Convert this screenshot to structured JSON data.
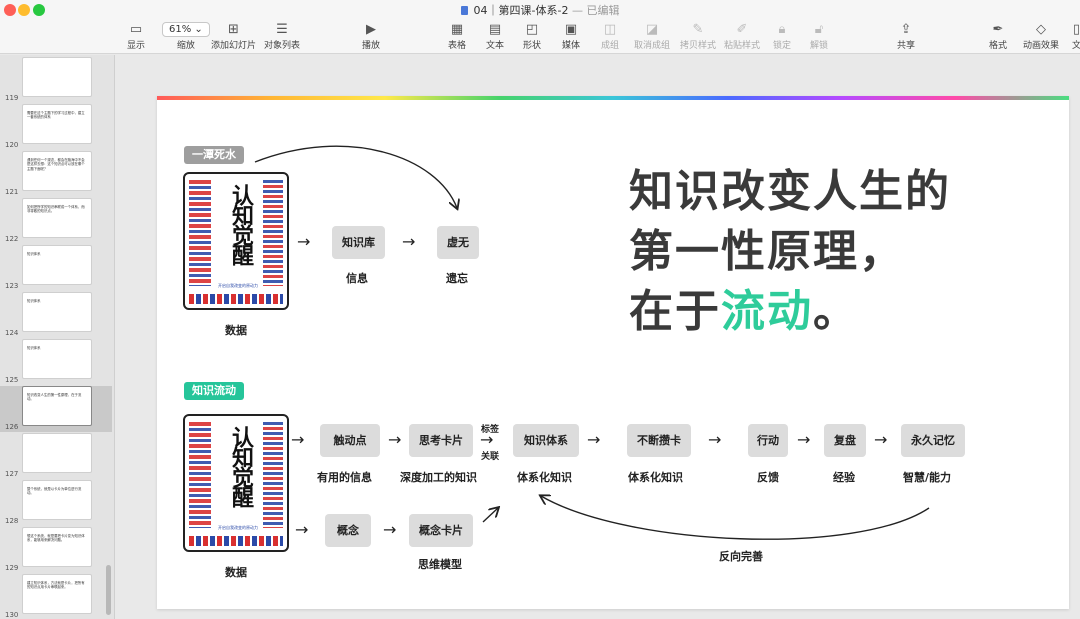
{
  "window": {
    "title": "04｜第四课-体系-2",
    "separator": "—",
    "status": "已编辑"
  },
  "toolbar": {
    "items": [
      {
        "label": "显示",
        "icon": "sidebar-icon"
      },
      {
        "label": "缩放",
        "icon": "zoom-select",
        "value": "61%"
      },
      {
        "label": "添加幻灯片",
        "icon": "add-slide-icon"
      },
      {
        "label": "对象列表",
        "icon": "list-icon"
      },
      {
        "label": "播放",
        "icon": "play-icon"
      },
      {
        "label": "表格",
        "icon": "table-icon"
      },
      {
        "label": "文本",
        "icon": "text-icon"
      },
      {
        "label": "形状",
        "icon": "shape-icon"
      },
      {
        "label": "媒体",
        "icon": "media-icon"
      },
      {
        "label": "成组",
        "icon": "group-icon"
      },
      {
        "label": "取消成组",
        "icon": "ungroup-icon"
      },
      {
        "label": "拷贝样式",
        "icon": "copy-style-icon"
      },
      {
        "label": "粘贴样式",
        "icon": "paste-style-icon"
      },
      {
        "label": "锁定",
        "icon": "lock-icon"
      },
      {
        "label": "解锁",
        "icon": "unlock-icon"
      },
      {
        "label": "共享",
        "icon": "share-icon"
      },
      {
        "label": "格式",
        "icon": "format-icon"
      },
      {
        "label": "动画效果",
        "icon": "animate-icon"
      },
      {
        "label": "文",
        "icon": "document-icon"
      }
    ]
  },
  "sidebar": {
    "slides": [
      {
        "number": "119",
        "text": ""
      },
      {
        "number": "120",
        "text": "需要在这个主题下的学习过程中，建立一套系统的体系"
      },
      {
        "number": "121",
        "text": "遇到任何一个观念，都会在脑海中不会是这样去想：这个知识点可以放在哪个主题下面呢？"
      },
      {
        "number": "122",
        "text": "如何把所学的知识串联成一个体系，而非零散的知识点。"
      },
      {
        "number": "123",
        "text": "知识体系"
      },
      {
        "number": "124",
        "text": "知识体系"
      },
      {
        "number": "125",
        "text": "知识体系"
      },
      {
        "number": "126",
        "text": "知识改变人生的第一性原理，在于流动。",
        "selected": true
      },
      {
        "number": "127",
        "text": ""
      },
      {
        "number": "128",
        "text": "整个系统，就是以卡片为单位进行流动。"
      },
      {
        "number": "129",
        "text": "想这个系统，就是要把卡片变为知识体系，能够用来解决问题。"
      },
      {
        "number": "130",
        "text": "建立知识体系，方法就是卡片，把所有的知识点用卡片串联起来。"
      }
    ]
  },
  "slide": {
    "tag_top": "一潭死水",
    "tag_bottom": "知识流动",
    "book_title": "认知觉醒",
    "book_subtitle": "开启自我改变的原动力",
    "top_flow": {
      "box1": "知识库",
      "box1_label": "信息",
      "box2": "虚无",
      "box2_label": "遗忘",
      "book_label": "数据"
    },
    "headline": {
      "line1": "知识改变人生的",
      "line2": "第一性原理，",
      "line3_pre": "在于",
      "line3_hl": "流动",
      "line3_post": "。"
    },
    "bottom_flow": {
      "book_label": "数据",
      "trigger": "触动点",
      "trigger_label": "有用的信息",
      "card": "思考卡片",
      "card_label": "深度加工的知识",
      "link_top": "标签",
      "link_bottom": "关联",
      "system": "知识体系",
      "system_label": "体系化知识",
      "accum": "不断攒卡",
      "accum_label": "体系化知识",
      "action": "行动",
      "action_label": "反馈",
      "review": "复盘",
      "review_label": "经验",
      "memory": "永久记忆",
      "memory_label": "智慧/能力",
      "concept": "概念",
      "concept_card": "概念卡片",
      "concept_card_label": "思维模型",
      "loop_label": "反向完善"
    }
  },
  "colors": {
    "accent_green": "#26c59a",
    "highlight": "#2ecc9a",
    "tag_gray": "#9e9e9e",
    "box_gray": "#dcdcdc"
  }
}
